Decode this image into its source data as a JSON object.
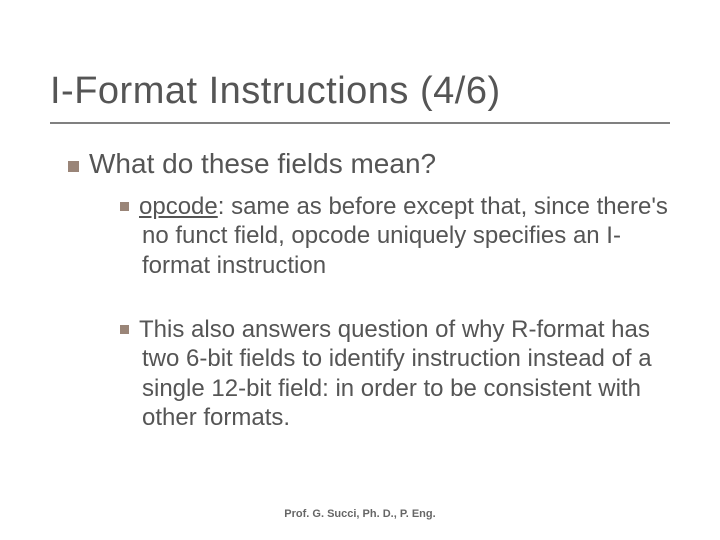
{
  "title": "I-Format Instructions (4/6)",
  "lvl1": "What do these fields mean?",
  "item1_term": "opcode",
  "item1_rest": ": same as before except that, since there's no funct field, opcode uniquely specifies an I-format instruction",
  "item2": "This also answers question of why R-format has two 6-bit fields to identify instruction instead of a single 12-bit field: in order to be consistent with other formats.",
  "footer": "Prof. G. Succi, Ph. D., P. Eng."
}
